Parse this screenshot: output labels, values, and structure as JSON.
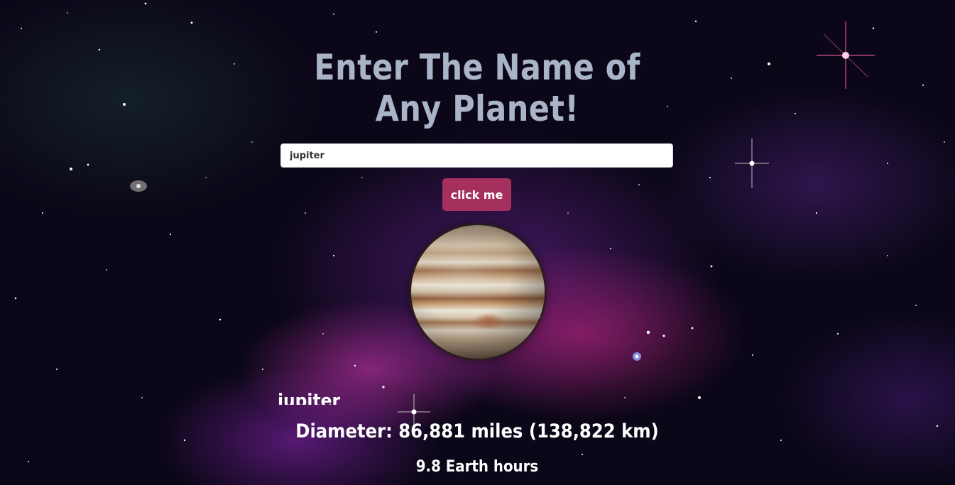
{
  "page": {
    "title": "Enter The Name of Any Planet!"
  },
  "search": {
    "value": "jupiter",
    "button_label": "click me"
  },
  "result": {
    "planet_name": "jupiter",
    "diameter": "Diameter: 86,881 miles (138,822 km)",
    "day_length": "9.8 Earth hours"
  },
  "colors": {
    "title_text": "#aab4c8",
    "button_background": "#a5305e",
    "background": "#0b0718"
  },
  "icons": {
    "planet_image": "jupiter-planet-image"
  }
}
